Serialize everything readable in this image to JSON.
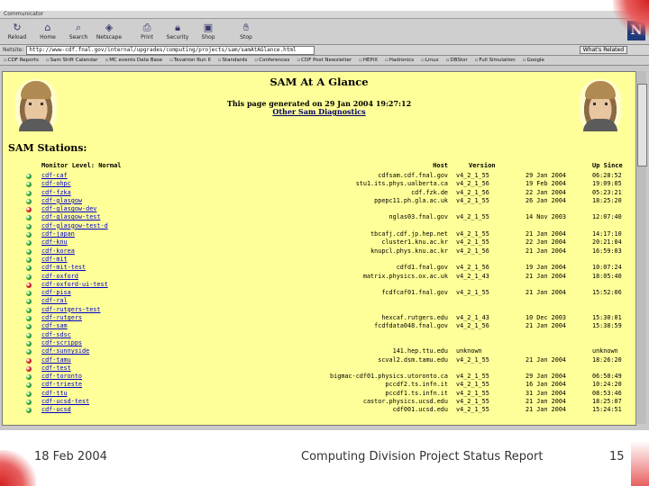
{
  "browser": {
    "menus": [
      "Communicator"
    ],
    "toolbar": [
      {
        "label": "Reload",
        "icon": "reload-icon"
      },
      {
        "label": "Home",
        "icon": "home-icon"
      },
      {
        "label": "Search",
        "icon": "search-icon"
      },
      {
        "label": "Netscape",
        "icon": "netscape-icon"
      },
      {
        "label": "Print",
        "icon": "print-icon"
      },
      {
        "label": "Security",
        "icon": "security-icon"
      },
      {
        "label": "Shop",
        "icon": "shop-icon"
      },
      {
        "label": "Stop",
        "icon": "stop-icon"
      }
    ],
    "location_label": "Netsite:",
    "location_url": "http://www-cdf.fnal.gov/internal/upgrades/computing/projects/sam/samAtAGlance.html",
    "whats_related": "What's Related",
    "bookmarks": [
      "CDF Reports",
      "Sam Shift Calendar",
      "MC events Data Base",
      "Tevatron Run II",
      "Standards",
      "Conferences",
      "CDF Post Newsletter",
      "HEPiX",
      "Hadronics",
      "Linux",
      "DBStor",
      "Full Simulation",
      "Google"
    ]
  },
  "page": {
    "title": "SAM At A Glance",
    "generated": "This page generated on 29 Jan 2004 19:27:12",
    "diagnostics_link": "Other Sam Diagnostics",
    "stations_title": "SAM Stations:",
    "columns": {
      "monitor": "Monitor Level: Normal",
      "host": "Host",
      "version": "Version",
      "up_since": "Up Since"
    },
    "stations": [
      {
        "name": "cdf-caf",
        "host": "cdfsam.cdf.fnal.gov",
        "version": "v4_2_1_55",
        "date": "29 Jan 2004",
        "time": "06:28:52",
        "status": "green"
      },
      {
        "name": "cdf-ohpc",
        "host": "stu1.its.phys.ualberta.ca",
        "version": "v4_2_1_56",
        "date": "19 Feb 2004",
        "time": "19:09:05",
        "status": "green"
      },
      {
        "name": "cdf-fzka",
        "host": "cdf.fzk.de",
        "version": "v4_2_1_56",
        "date": "22 Jan 2004",
        "time": "05:23:21",
        "status": "green"
      },
      {
        "name": "cdf-glasgow",
        "host": "ppepc11.ph.gla.ac.uk",
        "version": "v4_2_1_55",
        "date": "26 Jan 2004",
        "time": "18:25:20",
        "status": "green"
      },
      {
        "name": "cdf-glasgow-dev",
        "host": "",
        "version": "",
        "date": "",
        "time": "",
        "status": "red"
      },
      {
        "name": "cdf-glasgow-test",
        "host": "nglas03.fnal.gov",
        "version": "v4_2_1_55",
        "date": "14 Nov 2003",
        "time": "12:07:40",
        "status": "green"
      },
      {
        "name": "cdf-glasgow-test-d",
        "host": "",
        "version": "",
        "date": "",
        "time": "",
        "status": "green"
      },
      {
        "name": "cdf-japan",
        "host": "tbcafj.cdf.jp.hep.net",
        "version": "v4_2_1_55",
        "date": "21 Jan 2004",
        "time": "14:17:10",
        "status": "green"
      },
      {
        "name": "cdf-knu",
        "host": "cluster1.knu.ac.kr",
        "version": "v4_2_1_55",
        "date": "22 Jan 2004",
        "time": "20:21:04",
        "status": "green"
      },
      {
        "name": "cdf-korea",
        "host": "knupcl.phys.knu.ac.kr",
        "version": "v4_2_1_56",
        "date": "21 Jan 2004",
        "time": "16:59:03",
        "status": "green"
      },
      {
        "name": "cdf-mit",
        "host": "",
        "version": "",
        "date": "",
        "time": "",
        "status": "green"
      },
      {
        "name": "cdf-mit-test",
        "host": "cdfd1.fnal.gov",
        "version": "v4_2_1_56",
        "date": "19 Jan 2004",
        "time": "10:07:24",
        "status": "green"
      },
      {
        "name": "cdf-oxford",
        "host": "matrix.physics.ox.ac.uk",
        "version": "v4_2_1_43",
        "date": "21 Jan 2004",
        "time": "18:05:40",
        "status": "green"
      },
      {
        "name": "cdf-oxford-ui-test",
        "host": "",
        "version": "",
        "date": "",
        "time": "",
        "status": "red"
      },
      {
        "name": "cdf-pisa",
        "host": "fcdfcaf01.fnal.gov",
        "version": "v4_2_1_55",
        "date": "21 Jan 2004",
        "time": "15:52:06",
        "status": "green"
      },
      {
        "name": "cdf-ral",
        "host": "",
        "version": "",
        "date": "",
        "time": "",
        "status": "green"
      },
      {
        "name": "cdf-rutgers-test",
        "host": "",
        "version": "",
        "date": "",
        "time": "",
        "status": "green"
      },
      {
        "name": "cdf-rutgers",
        "host": "hexcaf.rutgers.edu",
        "version": "v4_2_1_43",
        "date": "10 Dec 2003",
        "time": "15:30:01",
        "status": "green"
      },
      {
        "name": "cdf-sam",
        "host": "fcdfdata048.fnal.gov",
        "version": "v4_2_1_56",
        "date": "21 Jan 2004",
        "time": "15:38:59",
        "status": "green"
      },
      {
        "name": "cdf-sdsc",
        "host": "",
        "version": "",
        "date": "",
        "time": "",
        "status": "green"
      },
      {
        "name": "cdf-scripps",
        "host": "",
        "version": "",
        "date": "",
        "time": "",
        "status": "green"
      },
      {
        "name": "cdf-sunnyside",
        "host": "141.hep.ttu.edu",
        "version": "unknown",
        "date": "",
        "time": "unknown",
        "status": "green"
      },
      {
        "name": "cdf-tamu",
        "host": "scval2.dsm.tamu.edu",
        "version": "v4_2_1_55",
        "date": "21 Jan 2004",
        "time": "18:26:20",
        "status": "red"
      },
      {
        "name": "cdf-test",
        "host": "",
        "version": "",
        "date": "",
        "time": "",
        "status": "red"
      },
      {
        "name": "cdf-toronto",
        "host": "bigmac-cdf01.physics.utoronto.ca",
        "version": "v4_2_1_55",
        "date": "29 Jan 2004",
        "time": "06:50:49",
        "status": "green"
      },
      {
        "name": "cdf-trieste",
        "host": "pccdf2.ts.infn.it",
        "version": "v4_2_1_55",
        "date": "16 Jan 2004",
        "time": "10:24:20",
        "status": "green"
      },
      {
        "name": "cdf-ttu",
        "host": "pccdf1.ts.infn.it",
        "version": "v4_2_1_55",
        "date": "31 Jan 2004",
        "time": "08:53:46",
        "status": "green"
      },
      {
        "name": "cdf-ucsd-test",
        "host": "castor.physics.ucsd.edu",
        "version": "v4_2_1_55",
        "date": "21 Jan 2004",
        "time": "18:25:07",
        "status": "green"
      },
      {
        "name": "cdf-ucsd",
        "host": "cdf001.ucsd.edu",
        "version": "v4_2_1_55",
        "date": "21 Jan 2004",
        "time": "15:24:51",
        "status": "green"
      }
    ]
  },
  "footer": {
    "date": "18 Feb 2004",
    "title": "Computing Division Project Status Report",
    "page": "15"
  },
  "colors": {
    "page_bg": "#ffff99",
    "ok": "#2e9e2e",
    "error": "#c81e1e",
    "link": "#0000cc"
  }
}
